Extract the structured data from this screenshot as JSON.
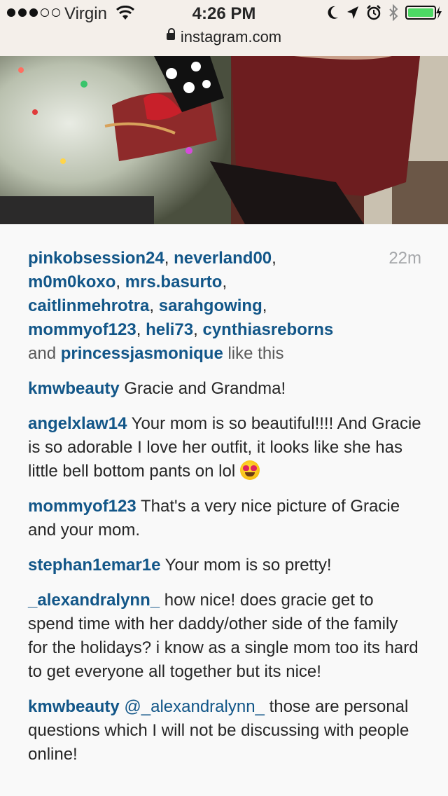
{
  "status_bar": {
    "carrier": "Virgin",
    "time": "4:26 PM",
    "url": "instagram.com",
    "signal_bars_filled": 3,
    "signal_bars_total": 5
  },
  "post": {
    "time_ago": "22m",
    "likes": {
      "users": [
        "pinkobsession24",
        "neverland00",
        "m0m0koxo",
        "mrs.basurto",
        "caitlinmehrotra",
        "sarahgowing",
        "mommyof123",
        "heli73",
        "cynthiasreborns"
      ],
      "and_label": "and",
      "last_user": "princessjasmonique",
      "suffix": "like this"
    },
    "comments": [
      {
        "user": "kmwbeauty",
        "text": "Gracie and Grandma!"
      },
      {
        "user": "angelxlaw14",
        "text": "Your mom is so beautiful!!!! And Gracie is so adorable I love her outfit, it looks like she has little bell bottom pants on lol"
      },
      {
        "user": "mommyof123",
        "text": "That's a very nice picture of Gracie and your mom."
      },
      {
        "user": "stephan1emar1e",
        "text": "Your mom is so pretty!"
      },
      {
        "user": "_alexandralynn_",
        "text": "how nice! does gracie get to spend time with her daddy/other side of the family for the holidays? i know as a single mom too its hard to get everyone all together but its nice!"
      },
      {
        "user": "kmwbeauty",
        "mention": "@_alexandralynn_",
        "text": "those are personal questions which I will not be discussing with people online!"
      }
    ]
  },
  "colors": {
    "link": "#125688",
    "time": "#a5a7aa",
    "battery": "#4cd964"
  },
  "icons": [
    "wifi-icon",
    "moon-icon",
    "location-arrow-icon",
    "alarm-icon",
    "bluetooth-icon",
    "battery-icon",
    "charging-icon",
    "lock-icon",
    "heart-eyes-emoji"
  ]
}
